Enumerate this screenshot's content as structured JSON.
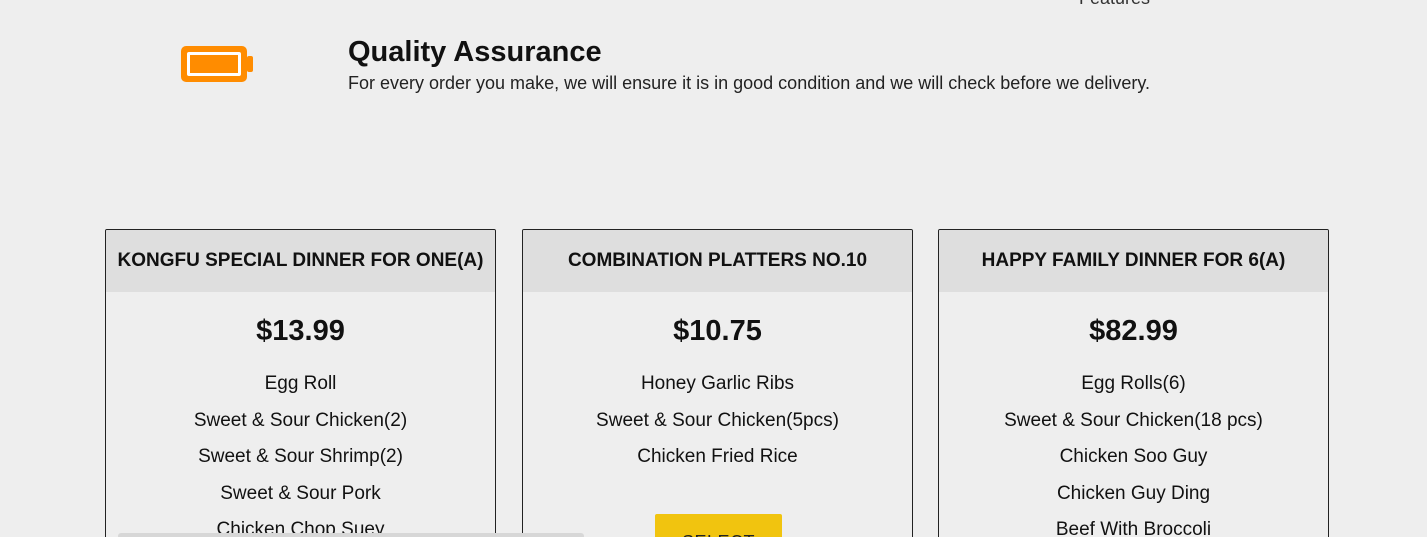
{
  "nav": {
    "features_label": "Features"
  },
  "quality": {
    "icon": "battery-icon",
    "title": "Quality Assurance",
    "description": "For every order you make, we will ensure it is in good condition and we will check before we delivery."
  },
  "colors": {
    "accent_orange": "#ff8c00",
    "select_yellow": "#f1c40f",
    "header_gray": "#dedede",
    "background": "#eeeeee"
  },
  "cards": [
    {
      "title": "KONGFU SPECIAL DINNER FOR ONE(A)",
      "price": "$13.99",
      "items": [
        "Egg Roll",
        "Sweet & Sour Chicken(2)",
        "Sweet & Sour Shrimp(2)",
        "Sweet & Sour Pork",
        "Chicken Chop Suey"
      ]
    },
    {
      "title": "COMBINATION PLATTERS NO.10",
      "price": "$10.75",
      "items": [
        "Honey Garlic Ribs",
        "Sweet & Sour Chicken(5pcs)",
        "Chicken Fried Rice"
      ],
      "button_label": "SELECT"
    },
    {
      "title": "HAPPY FAMILY DINNER FOR 6(A)",
      "price": "$82.99",
      "items": [
        "Egg Rolls(6)",
        "Sweet & Sour Chicken(18 pcs)",
        "Chicken Soo Guy",
        "Chicken Guy Ding",
        "Beef With Broccoli"
      ]
    }
  ]
}
